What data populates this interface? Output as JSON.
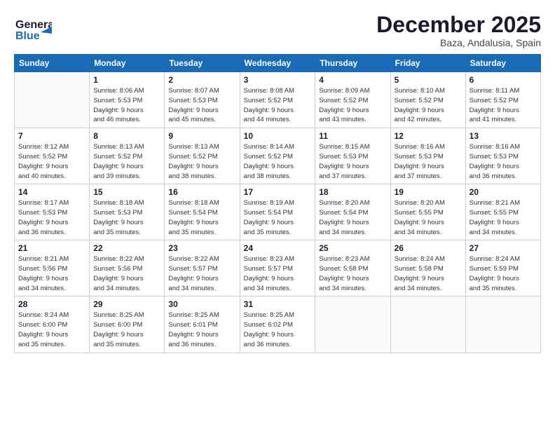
{
  "header": {
    "logo_general": "General",
    "logo_blue": "Blue",
    "title": "December 2025",
    "subtitle": "Baza, Andalusia, Spain"
  },
  "weekdays": [
    "Sunday",
    "Monday",
    "Tuesday",
    "Wednesday",
    "Thursday",
    "Friday",
    "Saturday"
  ],
  "weeks": [
    [
      {
        "day": "",
        "info": ""
      },
      {
        "day": "1",
        "info": "Sunrise: 8:06 AM\nSunset: 5:53 PM\nDaylight: 9 hours\nand 46 minutes."
      },
      {
        "day": "2",
        "info": "Sunrise: 8:07 AM\nSunset: 5:53 PM\nDaylight: 9 hours\nand 45 minutes."
      },
      {
        "day": "3",
        "info": "Sunrise: 8:08 AM\nSunset: 5:52 PM\nDaylight: 9 hours\nand 44 minutes."
      },
      {
        "day": "4",
        "info": "Sunrise: 8:09 AM\nSunset: 5:52 PM\nDaylight: 9 hours\nand 43 minutes."
      },
      {
        "day": "5",
        "info": "Sunrise: 8:10 AM\nSunset: 5:52 PM\nDaylight: 9 hours\nand 42 minutes."
      },
      {
        "day": "6",
        "info": "Sunrise: 8:11 AM\nSunset: 5:52 PM\nDaylight: 9 hours\nand 41 minutes."
      }
    ],
    [
      {
        "day": "7",
        "info": "Sunrise: 8:12 AM\nSunset: 5:52 PM\nDaylight: 9 hours\nand 40 minutes."
      },
      {
        "day": "8",
        "info": "Sunrise: 8:13 AM\nSunset: 5:52 PM\nDaylight: 9 hours\nand 39 minutes."
      },
      {
        "day": "9",
        "info": "Sunrise: 8:13 AM\nSunset: 5:52 PM\nDaylight: 9 hours\nand 38 minutes."
      },
      {
        "day": "10",
        "info": "Sunrise: 8:14 AM\nSunset: 5:52 PM\nDaylight: 9 hours\nand 38 minutes."
      },
      {
        "day": "11",
        "info": "Sunrise: 8:15 AM\nSunset: 5:53 PM\nDaylight: 9 hours\nand 37 minutes."
      },
      {
        "day": "12",
        "info": "Sunrise: 8:16 AM\nSunset: 5:53 PM\nDaylight: 9 hours\nand 37 minutes."
      },
      {
        "day": "13",
        "info": "Sunrise: 8:16 AM\nSunset: 5:53 PM\nDaylight: 9 hours\nand 36 minutes."
      }
    ],
    [
      {
        "day": "14",
        "info": "Sunrise: 8:17 AM\nSunset: 5:53 PM\nDaylight: 9 hours\nand 36 minutes."
      },
      {
        "day": "15",
        "info": "Sunrise: 8:18 AM\nSunset: 5:53 PM\nDaylight: 9 hours\nand 35 minutes."
      },
      {
        "day": "16",
        "info": "Sunrise: 8:18 AM\nSunset: 5:54 PM\nDaylight: 9 hours\nand 35 minutes."
      },
      {
        "day": "17",
        "info": "Sunrise: 8:19 AM\nSunset: 5:54 PM\nDaylight: 9 hours\nand 35 minutes."
      },
      {
        "day": "18",
        "info": "Sunrise: 8:20 AM\nSunset: 5:54 PM\nDaylight: 9 hours\nand 34 minutes."
      },
      {
        "day": "19",
        "info": "Sunrise: 8:20 AM\nSunset: 5:55 PM\nDaylight: 9 hours\nand 34 minutes."
      },
      {
        "day": "20",
        "info": "Sunrise: 8:21 AM\nSunset: 5:55 PM\nDaylight: 9 hours\nand 34 minutes."
      }
    ],
    [
      {
        "day": "21",
        "info": "Sunrise: 8:21 AM\nSunset: 5:56 PM\nDaylight: 9 hours\nand 34 minutes."
      },
      {
        "day": "22",
        "info": "Sunrise: 8:22 AM\nSunset: 5:56 PM\nDaylight: 9 hours\nand 34 minutes."
      },
      {
        "day": "23",
        "info": "Sunrise: 8:22 AM\nSunset: 5:57 PM\nDaylight: 9 hours\nand 34 minutes."
      },
      {
        "day": "24",
        "info": "Sunrise: 8:23 AM\nSunset: 5:57 PM\nDaylight: 9 hours\nand 34 minutes."
      },
      {
        "day": "25",
        "info": "Sunrise: 8:23 AM\nSunset: 5:58 PM\nDaylight: 9 hours\nand 34 minutes."
      },
      {
        "day": "26",
        "info": "Sunrise: 8:24 AM\nSunset: 5:58 PM\nDaylight: 9 hours\nand 34 minutes."
      },
      {
        "day": "27",
        "info": "Sunrise: 8:24 AM\nSunset: 5:59 PM\nDaylight: 9 hours\nand 35 minutes."
      }
    ],
    [
      {
        "day": "28",
        "info": "Sunrise: 8:24 AM\nSunset: 6:00 PM\nDaylight: 9 hours\nand 35 minutes."
      },
      {
        "day": "29",
        "info": "Sunrise: 8:25 AM\nSunset: 6:00 PM\nDaylight: 9 hours\nand 35 minutes."
      },
      {
        "day": "30",
        "info": "Sunrise: 8:25 AM\nSunset: 6:01 PM\nDaylight: 9 hours\nand 36 minutes."
      },
      {
        "day": "31",
        "info": "Sunrise: 8:25 AM\nSunset: 6:02 PM\nDaylight: 9 hours\nand 36 minutes."
      },
      {
        "day": "",
        "info": ""
      },
      {
        "day": "",
        "info": ""
      },
      {
        "day": "",
        "info": ""
      }
    ]
  ]
}
